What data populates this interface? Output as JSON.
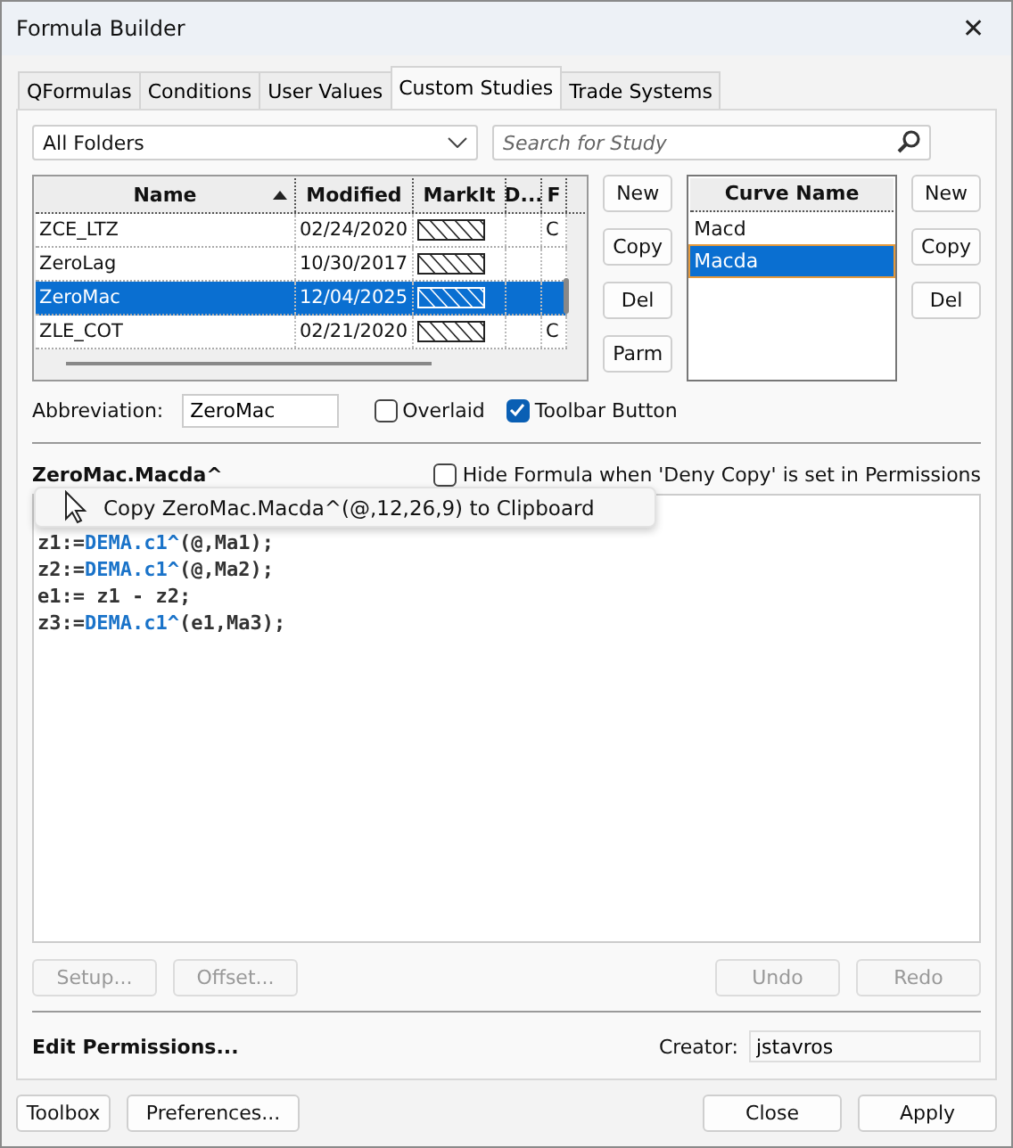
{
  "window": {
    "title": "Formula Builder",
    "close": "✕"
  },
  "tabs": [
    {
      "label": "QFormulas",
      "selected": false
    },
    {
      "label": "Conditions",
      "selected": false
    },
    {
      "label": "User Values",
      "selected": false
    },
    {
      "label": "Custom Studies",
      "selected": true
    },
    {
      "label": "Trade Systems",
      "selected": false
    }
  ],
  "folder_select": {
    "value": "All Folders"
  },
  "search": {
    "placeholder": "Search for Study"
  },
  "studies_table": {
    "columns": [
      {
        "label": "Name",
        "sorted": true
      },
      {
        "label": "Modified",
        "sorted": false
      },
      {
        "label": "MarkIt",
        "sorted": false
      },
      {
        "label": "D...",
        "sorted": false
      },
      {
        "label": "F",
        "sorted": false
      }
    ],
    "rows": [
      {
        "name": "ZCE_LTZ",
        "modified": "02/24/2020",
        "column_5": "C",
        "selected": false
      },
      {
        "name": "ZeroLag",
        "modified": "10/30/2017",
        "selected": false
      },
      {
        "name": "ZeroMac",
        "modified": "12/04/2025",
        "selected": true
      },
      {
        "name": "ZLE_COT",
        "modified": "02/21/2020",
        "column_5": "C",
        "selected": false
      }
    ]
  },
  "study_buttons": [
    "New",
    "Copy",
    "Del",
    "Parm"
  ],
  "curves": {
    "heading": "Curve Name",
    "items": [
      {
        "label": "Macd",
        "selected": false
      },
      {
        "label": "Macda",
        "selected": true
      }
    ]
  },
  "curve_buttons": [
    "New",
    "Copy",
    "Del"
  ],
  "abbreviation": {
    "label": "Abbreviation:",
    "value": "ZeroMac"
  },
  "options": [
    {
      "label": "Overlaid",
      "checked": false
    },
    {
      "label": "Toolbar Button",
      "checked": true
    }
  ],
  "formula": {
    "title": "ZeroMac.Macda^",
    "hide_option": {
      "label": "Hide Formula when 'Deny Copy' is set in Permissions",
      "checked": false
    },
    "lines": [
      [
        {
          "text": "z1:=",
          "kind": "plain"
        },
        {
          "text": "DEMA.c1^",
          "kind": "call"
        },
        {
          "text": "(@,Ma1);",
          "kind": "plain"
        }
      ],
      [
        {
          "text": "z2:=",
          "kind": "plain"
        },
        {
          "text": "DEMA.c1^",
          "kind": "call"
        },
        {
          "text": "(@,Ma2);",
          "kind": "plain"
        }
      ],
      [
        {
          "text": "e1:= z1 - z2;",
          "kind": "plain"
        }
      ],
      [
        {
          "text": "z3:=",
          "kind": "plain"
        },
        {
          "text": "DEMA.c1^",
          "kind": "call"
        },
        {
          "text": "(e1,Ma3);",
          "kind": "plain"
        }
      ]
    ],
    "tooltip": "Copy ZeroMac.Macda^(@,12,26,9) to Clipboard"
  },
  "editor_buttons": [
    {
      "label": "Setup...",
      "disabled": true
    },
    {
      "label": "Offset...",
      "disabled": true
    },
    {
      "label": "Undo",
      "disabled": true
    },
    {
      "label": "Redo",
      "disabled": true
    }
  ],
  "permissions_link": "Edit Permissions...",
  "creator": {
    "label": "Creator:",
    "value": "jstavros"
  },
  "footer_buttons": [
    "Toolbox",
    "Preferences...",
    "Close",
    "Apply"
  ]
}
